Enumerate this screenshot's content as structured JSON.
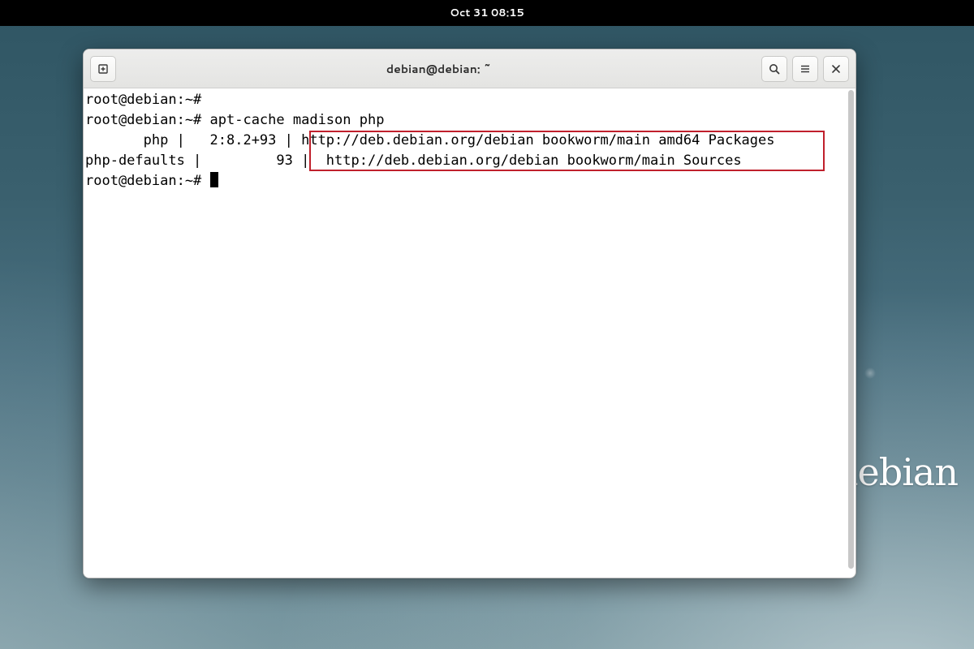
{
  "topbar": {
    "clock": "Oct 31  08:15"
  },
  "wallpaper": {
    "distro_name": "debian"
  },
  "window": {
    "title": "debian@debian: ~",
    "buttons": {
      "new_tab": "new-tab",
      "search": "search",
      "menu": "hamburger-menu",
      "close": "close"
    }
  },
  "terminal": {
    "prompt": "root@debian:~#",
    "lines": [
      {
        "text": "root@debian:~#",
        "hl": false
      },
      {
        "text": "root@debian:~# apt-cache madison php",
        "hl": false
      },
      {
        "text": "       php |   2:8.2+93 | http://deb.debian.org/debian bookworm/main amd64 Packages",
        "hl_start": 27,
        "hl_end": 89
      },
      {
        "text": "php-defaults |         93 |  http://deb.debian.org/debian bookworm/main Sources",
        "hl_start": 27,
        "hl_end": 89
      },
      {
        "text": "root@debian:~# ",
        "cursor": true
      }
    ],
    "highlight_box_color": "#c0202c"
  }
}
